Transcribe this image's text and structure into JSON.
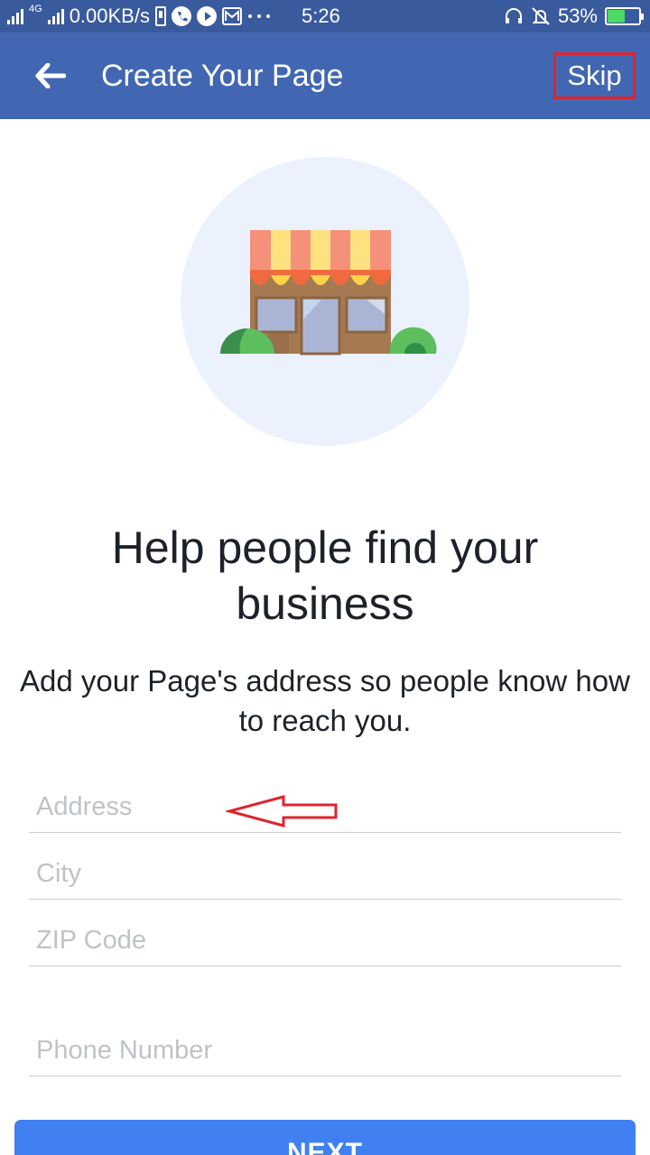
{
  "status_bar": {
    "network_type": "4G",
    "speed": "0.00KB/s",
    "time": "5:26",
    "battery": "53%",
    "battery_level": 0.53,
    "icons": [
      "signal-icon",
      "signal-icon",
      "phone-icon",
      "play-icon",
      "mail-icon",
      "more-icon",
      "headset-icon",
      "mute-icon",
      "battery-icon"
    ]
  },
  "app_bar": {
    "title": "Create Your Page",
    "skip_label": "Skip",
    "back_icon": "arrow-left-icon",
    "color": "#4267b2"
  },
  "main": {
    "illustration": "storefront-icon",
    "headline": "Help people find your business",
    "subtext": "Add your Page's address so people know how to reach you."
  },
  "form": {
    "address_placeholder": "Address",
    "city_placeholder": "City",
    "zip_placeholder": "ZIP Code",
    "phone_placeholder": "Phone Number"
  },
  "annotation": {
    "highlight_color": "#e0232c"
  },
  "footer": {
    "next_label": "NEXT"
  }
}
